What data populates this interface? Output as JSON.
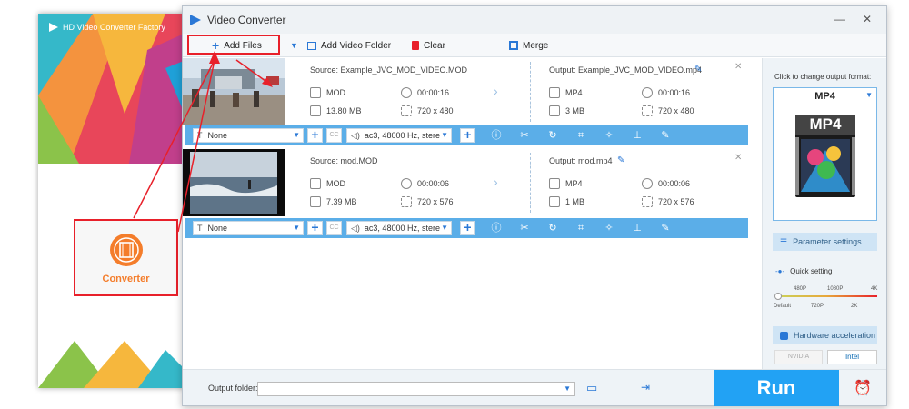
{
  "launcher": {
    "title": "HD Video Converter Factory",
    "converter_label": "Converter"
  },
  "window": {
    "title": "Video Converter"
  },
  "toolbar": {
    "add_files": "Add Files",
    "add_folder": "Add Video Folder",
    "clear": "Clear",
    "merge": "Merge"
  },
  "files": [
    {
      "source": "Source: Example_JVC_MOD_VIDEO.MOD",
      "output": "Output: Example_JVC_MOD_VIDEO.mp4",
      "src_format": "MOD",
      "src_duration": "00:00:16",
      "src_size": "13.80 MB",
      "src_res": "720 x 480",
      "out_format": "MP4",
      "out_duration": "00:00:16",
      "out_size": "3 MB",
      "out_res": "720 x 480",
      "subtitle": "None",
      "audio": "ac3, 48000 Hz, stere"
    },
    {
      "source": "Source: mod.MOD",
      "output": "Output: mod.mp4",
      "src_format": "MOD",
      "src_duration": "00:00:06",
      "src_size": "7.39 MB",
      "src_res": "720 x 576",
      "out_format": "MP4",
      "out_duration": "00:00:06",
      "out_size": "1 MB",
      "out_res": "720 x 576",
      "subtitle": "None",
      "audio": "ac3, 48000 Hz, stere"
    }
  ],
  "right_panel": {
    "change_format_label": "Click to change output format:",
    "format": "MP4",
    "format_badge": "MP4",
    "parameter_settings": "Parameter settings",
    "quick_setting": "Quick setting",
    "quality_top": [
      "480P",
      "1080P",
      "4K"
    ],
    "quality_bottom": [
      "Default",
      "720P",
      "2K"
    ],
    "hardware_accel": "Hardware acceleration",
    "nvidia": "NVIDIA",
    "intel": "Intel"
  },
  "bottom": {
    "output_folder_label": "Output folder:",
    "run": "Run"
  },
  "colors": {
    "accent": "#22a2f4",
    "bar": "#5baee8",
    "highlight": "#e8202a",
    "converter": "#f47d2b"
  }
}
